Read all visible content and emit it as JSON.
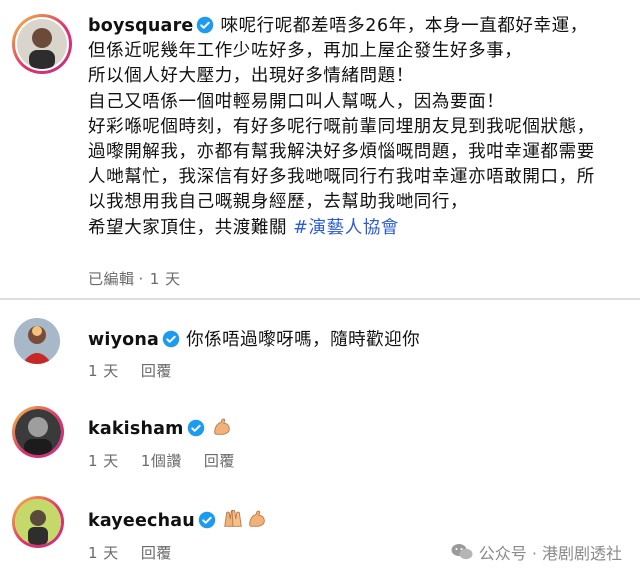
{
  "post": {
    "username": "boysquare",
    "caption_lines": [
      "唻呢行呢都差唔多26年，本身一直都好幸運，",
      "但係近呢幾年工作少咗好多，再加上屋企發生好多事，",
      "所以個人好大壓力，出現好多情緒問題！",
      "自己又唔係一個咁輕易開口叫人幫嘅人，因為要面！",
      "好彩喺呢個時刻，有好多呢行嘅前輩同埋朋友見到我呢個狀態，",
      "過嚟開解我，亦都有幫我解決好多煩惱嘅問題，我咁幸運都需要",
      "人哋幫忙，我深信有好多我哋嘅同行冇我咁幸運亦唔敢開口，所",
      "以我想用我自己嘅親身經歷，去幫助我哋同行，"
    ],
    "last_line_text": "希望大家頂住，共渡難關 ",
    "hashtag": "#演藝人協會",
    "edited": "已編輯",
    "separator": "·",
    "time": "1 天"
  },
  "comments": [
    {
      "username": "wiyona",
      "text": "你係唔過嚟呀嗎，隨時歡迎你",
      "time": "1 天",
      "reply": "回覆"
    },
    {
      "username": "kakisham",
      "emoji": [
        "flexed-biceps-emoji"
      ],
      "time": "1 天",
      "likes": "1個讚",
      "reply": "回覆"
    },
    {
      "username": "kayeechau",
      "emoji": [
        "raising-hands-emoji",
        "flexed-biceps-emoji"
      ],
      "time": "1 天",
      "reply": "回覆"
    }
  ],
  "watermark": {
    "label": "公众号 · 港剧剧透社"
  },
  "colors": {
    "verified": "#1d9bf0",
    "hashtag": "#2b5bd7",
    "ring_start": "#f9c23c",
    "ring_end": "#c13584"
  }
}
